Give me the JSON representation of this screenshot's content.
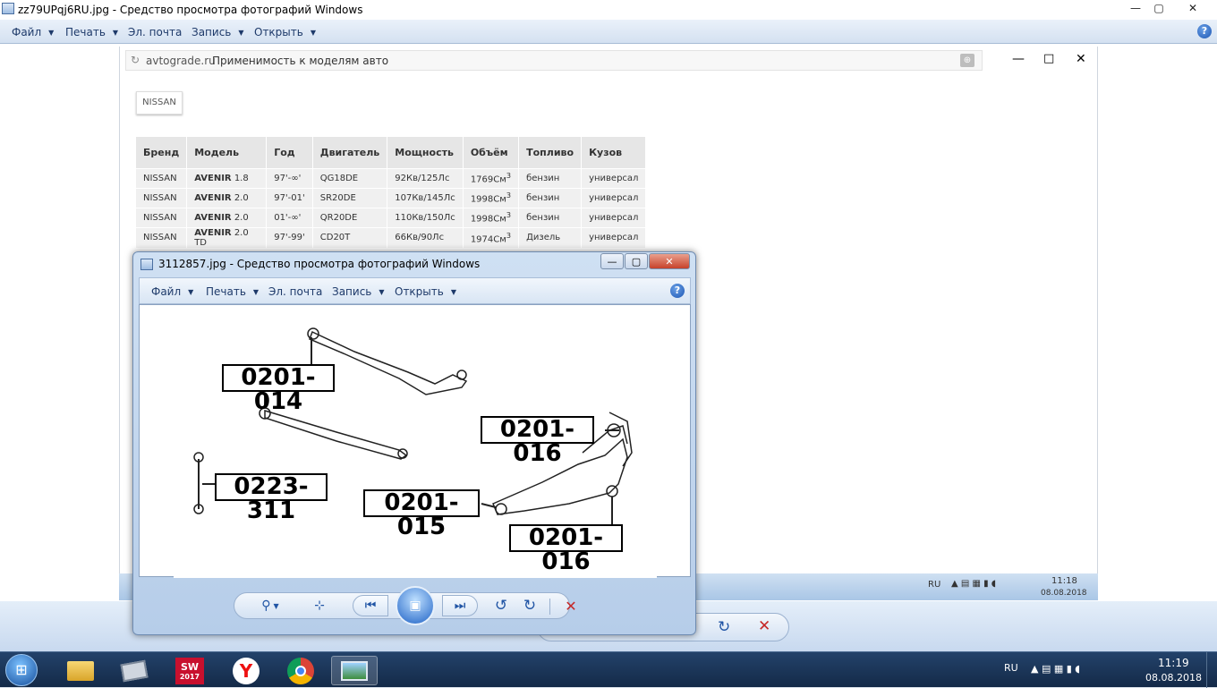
{
  "window": {
    "title": "zz79UPqj6RU.jpg - Средство просмотра фотографий Windows",
    "min": "—",
    "max": "▢",
    "close": "✕"
  },
  "menu": {
    "file": "Файл",
    "print": "Печать",
    "email": "Эл. почта",
    "burn": "Запись",
    "open": "Открыть"
  },
  "browser": {
    "site": "avtograde.ru",
    "page_title": "Применимость к моделям авто",
    "brand_button": "NISSAN"
  },
  "table": {
    "headers": [
      "Бренд",
      "Модель",
      "Год",
      "Двигатель",
      "Мощность",
      "Объём",
      "Топливо",
      "Кузов"
    ],
    "rows": [
      {
        "brand": "NISSAN",
        "model": "AVENIR",
        "trim": "1.8",
        "year": "97'-∞'",
        "engine": "QG18DE",
        "power": "92Кв/125Лс",
        "volume": "1769См",
        "fuel": "бензин",
        "body": "универсал"
      },
      {
        "brand": "NISSAN",
        "model": "AVENIR",
        "trim": "2.0",
        "year": "97'-01'",
        "engine": "SR20DE",
        "power": "107Кв/145Лс",
        "volume": "1998См",
        "fuel": "бензин",
        "body": "универсал"
      },
      {
        "brand": "NISSAN",
        "model": "AVENIR",
        "trim": "2.0",
        "year": "01'-∞'",
        "engine": "QR20DE",
        "power": "110Кв/150Лс",
        "volume": "1998См",
        "fuel": "бензин",
        "body": "универсал"
      },
      {
        "brand": "NISSAN",
        "model": "AVENIR",
        "trim": "2.0 TD",
        "year": "97'-99'",
        "engine": "CD20T",
        "power": "66Кв/90Лс",
        "volume": "1974См",
        "fuel": "Дизель",
        "body": "универсал"
      }
    ],
    "unit_sup": "3"
  },
  "inner_tray": {
    "lang": "RU",
    "time": "11:18",
    "date": "08.08.2018"
  },
  "viewer2": {
    "title": "3112857.jpg - Средство просмотра фотографий Windows",
    "labels": {
      "a": "0201-014",
      "b": "0201-016",
      "c": "0223-311",
      "d": "0201-015",
      "e": "0201-016"
    }
  },
  "taskbar": {
    "lang": "RU",
    "time": "11:19",
    "date": "08.08.2018",
    "sw_badge": "2017"
  }
}
